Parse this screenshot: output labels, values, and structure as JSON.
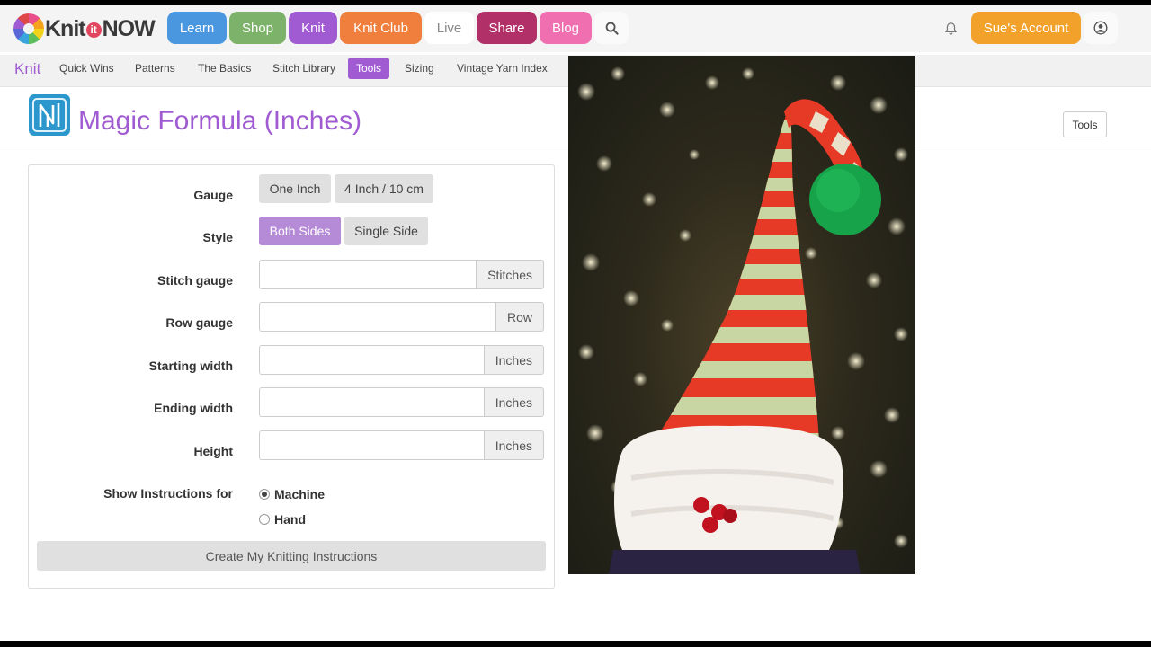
{
  "brand": {
    "logo_text_1": "Knit",
    "logo_text_it": "it",
    "logo_text_2": "NOW"
  },
  "topnav": {
    "items": [
      {
        "label": "Learn",
        "color": "#4a97e0"
      },
      {
        "label": "Shop",
        "color": "#7db26a"
      },
      {
        "label": "Knit",
        "color": "#a05bd3"
      },
      {
        "label": "Knit Club",
        "color": "#f07e3d"
      },
      {
        "label": "Live",
        "color": "#ffffff"
      },
      {
        "label": "Share",
        "color": "#b03067"
      },
      {
        "label": "Blog",
        "color": "#ef6fb0"
      }
    ],
    "search_icon": "search-icon",
    "notifications_icon": "bell-icon",
    "account_label": "Sue's Account",
    "user_icon": "user-circle-icon"
  },
  "subnav": {
    "title": "Knit",
    "items": [
      {
        "label": "Quick Wins",
        "active": false
      },
      {
        "label": "Patterns",
        "active": false
      },
      {
        "label": "The Basics",
        "active": false
      },
      {
        "label": "Stitch Library",
        "active": false
      },
      {
        "label": "Tools",
        "active": true
      },
      {
        "label": "Sizing",
        "active": false
      },
      {
        "label": "Vintage Yarn Index",
        "active": false
      }
    ]
  },
  "header": {
    "title": "Magic Formula (Inches)",
    "tools_button": "Tools"
  },
  "form": {
    "gauge": {
      "label": "Gauge",
      "options": [
        "One Inch",
        "4 Inch / 10 cm"
      ],
      "selected": null
    },
    "style": {
      "label": "Style",
      "options": [
        "Both Sides",
        "Single Side"
      ],
      "selected": "Both Sides"
    },
    "fields": [
      {
        "label": "Stitch gauge",
        "value": "",
        "unit": "Stitches"
      },
      {
        "label": "Row gauge",
        "value": "",
        "unit": "Row"
      },
      {
        "label": "Starting width",
        "value": "",
        "unit": "Inches"
      },
      {
        "label": "Ending width",
        "value": "",
        "unit": "Inches"
      },
      {
        "label": "Height",
        "value": "",
        "unit": "Inches"
      }
    ],
    "instructions": {
      "label": "Show Instructions for",
      "options": [
        {
          "label": "Machine",
          "checked": true
        },
        {
          "label": "Hand",
          "checked": false
        }
      ]
    },
    "submit_label": "Create My Knitting Instructions"
  },
  "colors": {
    "accent": "#a05bd3",
    "account": "#f2a22b",
    "toggle_active": "#b58ad6"
  }
}
